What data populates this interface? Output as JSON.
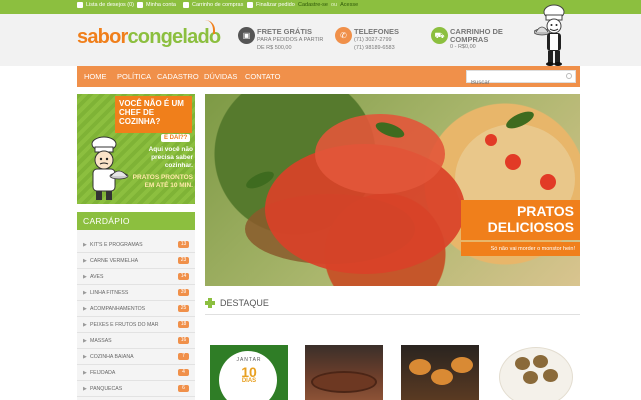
{
  "topbar": {
    "wishlist": "Lista de desejos (0)",
    "account": "Minha conta",
    "cart": "Carrinho de compras",
    "checkout": "Finalizar pedido",
    "register": "Cadastre-se",
    "or": "ou",
    "login": "Acesse"
  },
  "header": {
    "logo_a": "sabor",
    "logo_b": "congelado",
    "frete": {
      "title": "FRETE GRÁTIS",
      "line1": "PARA PEDIDOS A PARTIR",
      "line2": "DE R$ 500,00"
    },
    "telefones": {
      "title": "TELEFONES",
      "line1": "(71) 3027-2799",
      "line2": "(71) 98189-6583"
    },
    "carrinho": {
      "title": "CARRINHO DE",
      "title2": "COMPRAS",
      "line1": "0 - R$0,00"
    }
  },
  "nav": {
    "items": [
      "HOME",
      "POLÍTICA",
      "CADASTRO",
      "DÚVIDAS",
      "CONTATO"
    ],
    "search_placeholder": "Buscar"
  },
  "promo": {
    "question": "VOCÊ NÃO É UM CHEF DE COZINHA?",
    "dai": "E DAÍ??",
    "aqui": "Aqui você não precisa saber cozinhar.",
    "pratos": "PRATOS PRONTOS EM ATÉ 10 MIN."
  },
  "cardapio": {
    "title": "CARDÁPIO",
    "items": [
      {
        "label": "KIT'S E PROGRAMAS",
        "count": "13"
      },
      {
        "label": "CARNE VERMELHA",
        "count": "23"
      },
      {
        "label": "AVES",
        "count": "14"
      },
      {
        "label": "LINHA FITNESS",
        "count": "39"
      },
      {
        "label": "ACOMPANHAMENTOS",
        "count": "25"
      },
      {
        "label": "PEIXES E FRUTOS DO MAR",
        "count": "18"
      },
      {
        "label": "MASSAS",
        "count": "16"
      },
      {
        "label": "COZINHA BAIANA",
        "count": "7"
      },
      {
        "label": "FEIJOADA",
        "count": "4"
      },
      {
        "label": "PANQUECAS",
        "count": "6"
      }
    ]
  },
  "hero": {
    "title": "PRATOS DELICIOSOS",
    "subtitle": "Só não vai morder o monstor hein!"
  },
  "destaque": {
    "title": "DESTAQUE",
    "product1": {
      "line1": "JANTAR",
      "line2": "10",
      "line3": "DIAS",
      "line4": "LIGHT"
    }
  },
  "colors": {
    "green": "#8cbf3f",
    "orange": "#f07f1b",
    "nav_orange": "#f0904a"
  }
}
